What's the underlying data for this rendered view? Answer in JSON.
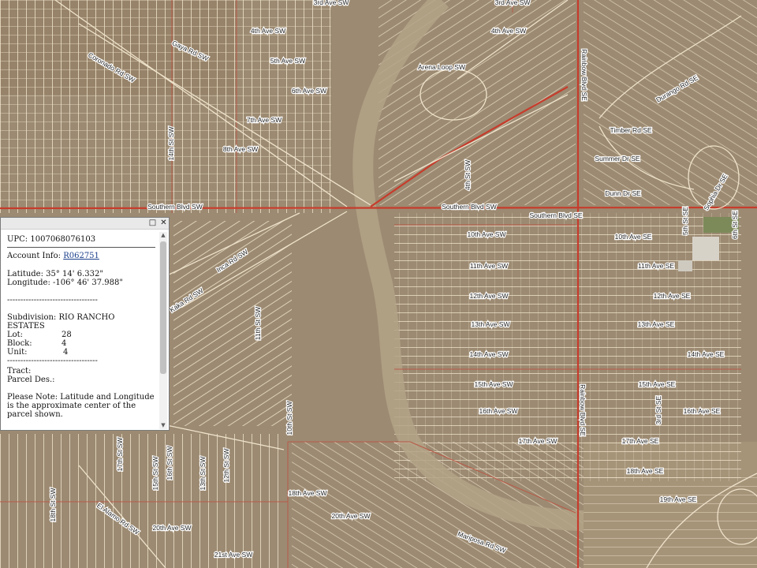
{
  "map": {
    "colors": {
      "ground": "#9c8a72",
      "parcel_line": "#f0e6d2",
      "major_road": "#c63c2c",
      "boundary": "#b85a48",
      "label_text": "#1e1e1e",
      "label_halo": "#ffffff"
    },
    "road_labels": [
      "3rd Ave SW",
      "3rd Ave SW",
      "4th Ave SW",
      "4th Ave SW",
      "5th Ave SW",
      "6th Ave SW",
      "7th Ave SW",
      "8th Ave SW",
      "Gaya Rd SW",
      "Coronado Rd SW",
      "Southern Blvd SW",
      "Southern Blvd SW",
      "Southern Blvd SE",
      "10th Ave SW",
      "10th Ave SE",
      "11th Ave SW",
      "11th Ave SE",
      "12th Ave SW",
      "12th Ave SE",
      "13th Ave SW",
      "13th Ave SE",
      "14th Ave SW",
      "14th Ave SE",
      "15th Ave SW",
      "15th Ave SE",
      "16th Ave SW",
      "16th Ave SE",
      "17th Ave SW",
      "17th Ave SE",
      "18th Ave SW",
      "18th Ave SE",
      "19th Ave SE",
      "20th Ave SW",
      "20th Ave SW",
      "21st Ave SW",
      "Rainbow Blvd SE",
      "Rainbow Blvd SE",
      "Inca Rd SW",
      "Kaka Rd SW",
      "Arena Loop SW",
      "Timber Rd SE",
      "Summer Dr SE",
      "Dunn Dr SE",
      "Sophia Dr SE",
      "Durango Rd SE",
      "Mariposa Rd SW",
      "El Alamo Rd SW",
      "18th St SW",
      "17th St SW",
      "16th St SW",
      "15th St SW",
      "14th St SW",
      "13th St SW",
      "12th St SW",
      "11th St SW",
      "10th St SW",
      "4th St SW",
      "3rd St SE",
      "5th St SE",
      "6th St SE"
    ]
  },
  "popup": {
    "upc_label": "UPC:",
    "upc_value": "1007068076103",
    "account_label": "Account Info:",
    "account_link": "R062751",
    "latitude_label": "Latitude:",
    "latitude_value": "35° 14' 6.332\"",
    "longitude_label": "Longitude:",
    "longitude_value": "-106° 46' 37.988\"",
    "separator": "----------------------------------",
    "subdivision_label": "Subdivision:",
    "subdivision_value": "RIO RANCHO ESTATES",
    "lot_label": "Lot:",
    "lot_value": "28",
    "block_label": "Block:",
    "block_value": "4",
    "unit_label": "Unit:",
    "unit_value": "4",
    "tract_label": "Tract:",
    "parcel_label": "Parcel Des.:",
    "note": "Please Note: Latitude and Longitude is the approximate center of the parcel shown.",
    "maximize_glyph": "□",
    "close_glyph": "✕",
    "scroll_up_glyph": "▲",
    "scroll_down_glyph": "▼"
  }
}
